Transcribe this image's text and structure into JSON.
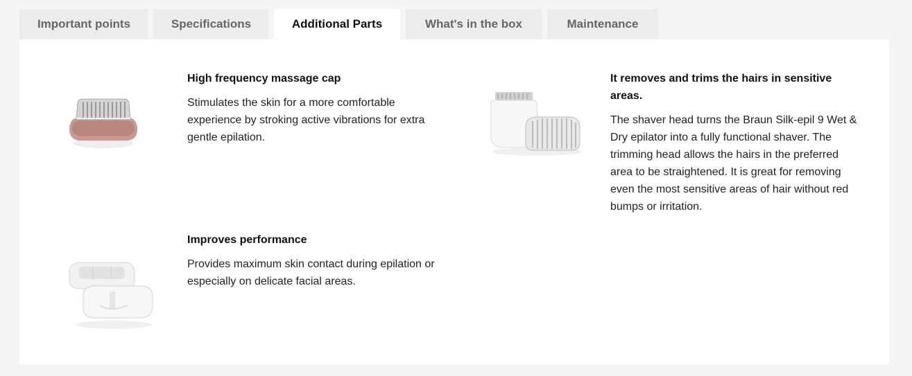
{
  "tabs": [
    {
      "label": "Important points",
      "active": false
    },
    {
      "label": "Specifications",
      "active": false
    },
    {
      "label": "Additional Parts",
      "active": true
    },
    {
      "label": "What's in the box",
      "active": false
    },
    {
      "label": "Maintenance",
      "active": false
    }
  ],
  "parts": [
    {
      "title": "High frequency massage cap",
      "description": "Stimulates the skin for a more comfortable experience by stroking active vibrations for extra gentle epilation.",
      "image_icon": "massage-cap-image"
    },
    {
      "title": "It removes and trims the hairs in sensitive areas.",
      "description": "The shaver head turns the Braun Silk-epil 9 Wet & Dry epilator into a fully functional shaver. The trimming head allows the hairs in the preferred area to be straightened. It is great for removing even the most sensitive areas of hair without red bumps or irritation.",
      "image_icon": "shaver-trimmer-heads-image"
    },
    {
      "title": "Improves performance",
      "description": "Provides maximum skin contact during epilation or especially on delicate facial areas.",
      "image_icon": "facial-caps-image"
    }
  ],
  "colors": {
    "page_bg": "#f5f5f5",
    "tab_bg": "#ececec",
    "tab_active_bg": "#ffffff",
    "tab_text": "#666666",
    "accent_rose": "#c99a94"
  }
}
